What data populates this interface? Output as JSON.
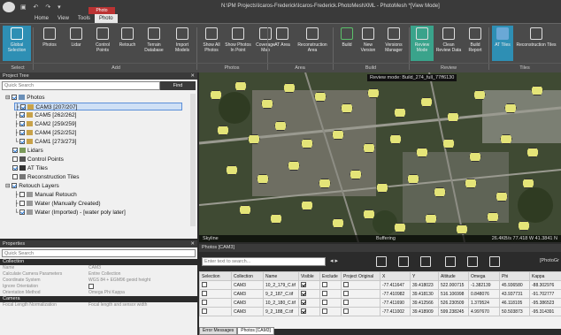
{
  "window": {
    "title": "N:\\PM Projects\\Icaros-Frederick\\Icaros-Frederick.PhotoMeshXML - PhotoMesh *[View Mode]",
    "context_tab": "Photo"
  },
  "menu_tabs": [
    "Home",
    "View",
    "Tools",
    "Photo"
  ],
  "ribbon": {
    "buttons": [
      {
        "id": "global-selection",
        "label": "Global Selection"
      },
      {
        "id": "photos",
        "label": "Photos"
      },
      {
        "id": "lidar",
        "label": "Lidar"
      },
      {
        "id": "control-points",
        "label": "Control Points"
      },
      {
        "id": "retouch",
        "label": "Retouch"
      },
      {
        "id": "terrain-database",
        "label": "Terrain Database"
      },
      {
        "id": "import-models",
        "label": "Import Models"
      },
      {
        "id": "show-all-photos",
        "label": "Show All Photos"
      },
      {
        "id": "show-photos-in-point",
        "label": "Show Photos In Point"
      },
      {
        "id": "coverage-map",
        "label": "Coverage Map"
      },
      {
        "id": "at-area",
        "label": "AT Area"
      },
      {
        "id": "reconstruction-area",
        "label": "Reconstruction Area"
      },
      {
        "id": "build",
        "label": "Build"
      },
      {
        "id": "new-version",
        "label": "New Version"
      },
      {
        "id": "versions-manager",
        "label": "Versions Manager"
      },
      {
        "id": "review-mode",
        "label": "Review Mode"
      },
      {
        "id": "clean-review-data",
        "label": "Clean Review Data"
      },
      {
        "id": "build-report",
        "label": "Build Report"
      },
      {
        "id": "at-tiles",
        "label": "AT Tiles"
      },
      {
        "id": "reconstruction-tiles",
        "label": "Reconstruction Tiles"
      }
    ],
    "groups": [
      "Select",
      "Add",
      "Photos",
      "Area",
      "Build",
      "Review",
      "Tiles"
    ]
  },
  "project_tree": {
    "title": "Project Tree",
    "search_placeholder": "Quick Search",
    "find_label": "Find",
    "items": [
      {
        "label": "Photos"
      },
      {
        "label": "CAM3 [207/207]"
      },
      {
        "label": "CAM5 [262/262]"
      },
      {
        "label": "CAM2 [259/259]"
      },
      {
        "label": "CAM4 [252/252]"
      },
      {
        "label": "CAM1 [273/273]"
      },
      {
        "label": "Lidars"
      },
      {
        "label": "Control Points"
      },
      {
        "label": "AT Tiles"
      },
      {
        "label": "Reconstruction Tiles"
      },
      {
        "label": "Retouch Layers"
      },
      {
        "label": "Manual Retouch"
      },
      {
        "label": "Water (Manually Created)"
      },
      {
        "label": "Water (Imported) - [water poly later]"
      }
    ]
  },
  "properties": {
    "title": "Properties",
    "search_placeholder": "Quick Search",
    "sections": [
      {
        "name": "Collection",
        "rows": [
          {
            "k": "Name",
            "v": "CAM3"
          },
          {
            "k": "Calculate Camera Parameters",
            "v": "Entire Collection"
          },
          {
            "k": "Coordinate System",
            "v": "WGS 84 + EGM96 geoid height"
          },
          {
            "k": "Ignore Orientation",
            "v": ""
          },
          {
            "k": "Orientation Method",
            "v": "Omega Phi Kappa"
          }
        ]
      },
      {
        "name": "Camera",
        "rows": [
          {
            "k": "Focal Length Normalization",
            "v": "Focal length and sensor width"
          }
        ]
      }
    ]
  },
  "map": {
    "banner": "Review mode: Build_274_full_77ff6130",
    "status_left": "Skyline",
    "status_mid": "Buffering",
    "status_right": "26.4KB/s   77.418 W   41.3841 N"
  },
  "photos_panel": {
    "title": "Photos [CAM3]",
    "search_placeholder": "Enter text to search...",
    "right_label": "[PhotoGr",
    "columns": [
      "Selection",
      "Collection",
      "Name",
      "Visible",
      "Exclude",
      "Project Original",
      "X",
      "Y",
      "Altitude",
      "Omega",
      "Phi",
      "Kappa"
    ],
    "rows": [
      {
        "collection": "CAM3",
        "name": "10_2_179_C.tif",
        "visible": true,
        "x": "-77.411647",
        "y": "39.418023",
        "alt": "522.000715",
        "omega": "-1.382139",
        "phi": "45.936580",
        "kappa": "-88.302976"
      },
      {
        "collection": "CAM3",
        "name": "9_2_187_C.tif",
        "visible": true,
        "x": "-77.410982",
        "y": "39.418130",
        "alt": "516.106998",
        "omega": "0.848076",
        "phi": "43.937731",
        "kappa": "-91.702777"
      },
      {
        "collection": "CAM3",
        "name": "10_2_180_C.tif",
        "visible": true,
        "x": "-77.411690",
        "y": "39.412566",
        "alt": "526.230509",
        "omega": "1.379524",
        "phi": "46.118105",
        "kappa": "-95.386523"
      },
      {
        "collection": "CAM3",
        "name": "9_2_188_C.tif",
        "visible": true,
        "x": "-77.411002",
        "y": "39.418909",
        "alt": "599.238245",
        "omega": "4.997670",
        "phi": "50.503873",
        "kappa": "-95.314391"
      }
    ]
  },
  "bottom_tabs": [
    "Error Messages",
    "Photos [CAM3]"
  ]
}
